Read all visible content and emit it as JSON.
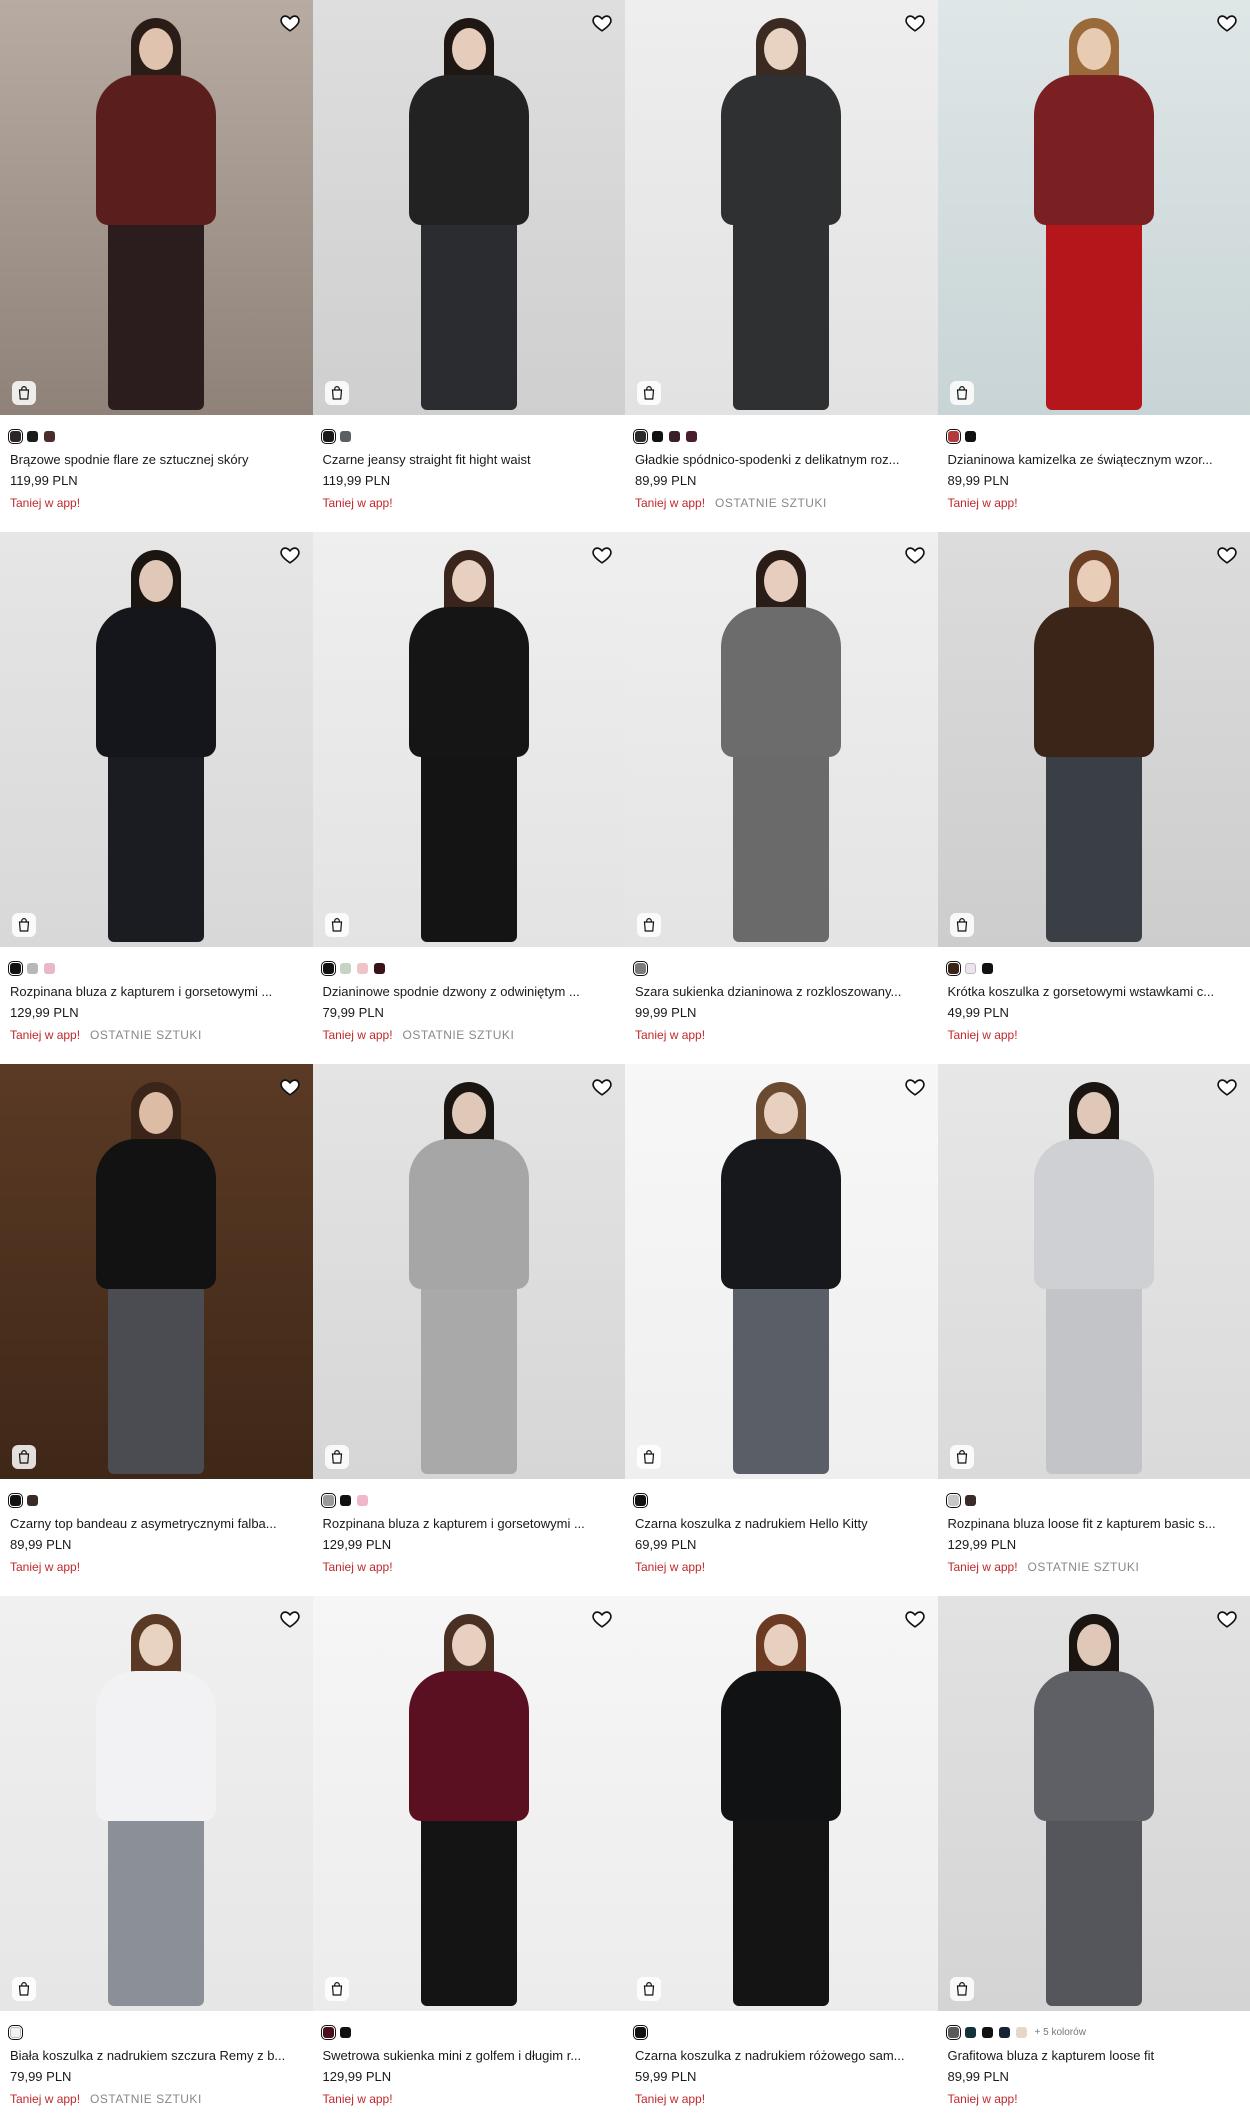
{
  "products": [
    {
      "name": "Brązowe spodnie flare ze sztucznej skóry",
      "price": "119,99 PLN",
      "promo": "Taniej w app!",
      "badge": "",
      "swatches": [
        "#2c2626",
        "#1c1c1c",
        "#4a2d2a"
      ],
      "more": "",
      "bg": [
        "#b7aba2",
        "#8f8279"
      ],
      "top": "#5a1f1d",
      "bottom": "#2b1c1d",
      "hair": "#2a1d17",
      "skin": "#e0c3ae"
    },
    {
      "name": "Czarne jeansy straight fit hight waist",
      "price": "119,99 PLN",
      "promo": "Taniej w app!",
      "badge": "",
      "swatches": [
        "#1a1a1a",
        "#5b5f63"
      ],
      "more": "",
      "bg": [
        "#dedede",
        "#cfcfcf"
      ],
      "top": "#222",
      "bottom": "#2a2c2f",
      "hair": "#1e1714",
      "skin": "#e6ccba"
    },
    {
      "name": "Gładkie spódnico-spodenki z delikatnym roz...",
      "price": "89,99 PLN",
      "promo": "Taniej w app!",
      "badge": "OSTATNIE SZTUKI",
      "swatches": [
        "#2b2b2b",
        "#111",
        "#3a1f26",
        "#4a1e2a"
      ],
      "more": "",
      "bg": [
        "#eeeeee",
        "#e2e2e2"
      ],
      "top": "#2f3032",
      "bottom": "#2f3032",
      "hair": "#3a2a22",
      "skin": "#e8d2c2"
    },
    {
      "name": "Dzianinowa kamizelka ze świątecznym wzor...",
      "price": "89,99 PLN",
      "promo": "Taniej w app!",
      "badge": "",
      "swatches": [
        "#b23a3a",
        "#111"
      ],
      "more": "",
      "bg": [
        "#dfe6e7",
        "#c8d4d6"
      ],
      "top": "#7a1f22",
      "bottom": "#b5161b",
      "hair": "#9a6a3a",
      "skin": "#e8cbb3"
    },
    {
      "name": "Rozpinana bluza z kapturem i gorsetowymi ...",
      "price": "129,99 PLN",
      "promo": "Taniej w app!",
      "badge": "OSTATNIE SZTUKI",
      "swatches": [
        "#111",
        "#b8b8b8",
        "#e9b7c8"
      ],
      "more": "",
      "bg": [
        "#e6e6e6",
        "#d8d8d8"
      ],
      "top": "#14161b",
      "bottom": "#1a1c22",
      "hair": "#1b1512",
      "skin": "#e0c8b8"
    },
    {
      "name": "Dzianinowe spodnie dzwony z odwiniętym ...",
      "price": "79,99 PLN",
      "promo": "Taniej w app!",
      "badge": "OSTATNIE SZTUKI",
      "swatches": [
        "#111",
        "#c9d2c6",
        "#efc4c8",
        "#3a1218"
      ],
      "more": "",
      "bg": [
        "#efefef",
        "#e3e3e3"
      ],
      "top": "#151515",
      "bottom": "#141414",
      "hair": "#3a251c",
      "skin": "#e8d0c0"
    },
    {
      "name": "Szara sukienka dzianinowa z rozkloszowany...",
      "price": "99,99 PLN",
      "promo": "Taniej w app!",
      "badge": "",
      "swatches": [
        "#7c7c7c"
      ],
      "more": "",
      "bg": [
        "#efefef",
        "#e4e4e4"
      ],
      "top": "#6c6c6c",
      "bottom": "#6a6a6a",
      "hair": "#2a1c16",
      "skin": "#e6cdbd"
    },
    {
      "name": "Krótka koszulka z gorsetowymi wstawkami c...",
      "price": "49,99 PLN",
      "promo": "Taniej w app!",
      "badge": "",
      "swatches": [
        "#3a2418",
        "#ece4ef",
        "#111"
      ],
      "more": "",
      "bg": [
        "#dcdcdc",
        "#cdcdcd"
      ],
      "top": "#3b2418",
      "bottom": "#3a3f46",
      "hair": "#6b3f24",
      "skin": "#e8cdb8"
    },
    {
      "name": "Czarny top bandeau z asymetrycznymi falba...",
      "price": "89,99 PLN",
      "promo": "Taniej w app!",
      "badge": "",
      "swatches": [
        "#111",
        "#3a2a28"
      ],
      "more": "",
      "bg": [
        "#5a3a24",
        "#3f2718"
      ],
      "top": "#121212",
      "bottom": "#4a4c52",
      "hair": "#3b2519",
      "skin": "#dcbca4"
    },
    {
      "name": "Rozpinana bluza z kapturem i gorsetowymi ...",
      "price": "129,99 PLN",
      "promo": "Taniej w app!",
      "badge": "",
      "swatches": [
        "#9a9a9a",
        "#111",
        "#efb7c8"
      ],
      "more": "",
      "bg": [
        "#e4e4e4",
        "#d6d6d6"
      ],
      "top": "#a6a6a6",
      "bottom": "#a9a9a9",
      "hair": "#1b1512",
      "skin": "#e0c8b8"
    },
    {
      "name": "Czarna koszulka z nadrukiem Hello Kitty",
      "price": "69,99 PLN",
      "promo": "Taniej w app!",
      "badge": "",
      "swatches": [
        "#111"
      ],
      "more": "",
      "bg": [
        "#f7f7f7",
        "#efefef"
      ],
      "top": "#16181c",
      "bottom": "#5a5e66",
      "hair": "#6a4a30",
      "skin": "#e8d0c0"
    },
    {
      "name": "Rozpinana bluza loose fit z kapturem basic s...",
      "price": "129,99 PLN",
      "promo": "Taniej w app!",
      "badge": "OSTATNIE SZTUKI",
      "swatches": [
        "#c6c6c6",
        "#3a2a28"
      ],
      "more": "",
      "bg": [
        "#e7e7e7",
        "#dadada"
      ],
      "top": "#cfd0d4",
      "bottom": "#c3c4c8",
      "hair": "#1b1512",
      "skin": "#e0c8b8"
    },
    {
      "name": "Biała koszulka z nadrukiem szczura Remy z b...",
      "price": "79,99 PLN",
      "promo": "Taniej w app!",
      "badge": "OSTATNIE SZTUKI",
      "swatches": [
        "#f2f2f2"
      ],
      "more": "",
      "bg": [
        "#f0f0f0",
        "#e6e6e6"
      ],
      "top": "#f2f2f4",
      "bottom": "#8b8f98",
      "hair": "#5a3a24",
      "skin": "#e8d2c2"
    },
    {
      "name": "Swetrowa sukienka mini z golfem i długim r...",
      "price": "129,99 PLN",
      "promo": "Taniej w app!",
      "badge": "",
      "swatches": [
        "#4a0f1c",
        "#111"
      ],
      "more": "",
      "bg": [
        "#f6f6f6",
        "#ececec"
      ],
      "top": "#5a1020",
      "bottom": "#141414",
      "hair": "#4a3022",
      "skin": "#e8d0c0"
    },
    {
      "name": "Czarna koszulka z nadrukiem różowego sam...",
      "price": "59,99 PLN",
      "promo": "Taniej w app!",
      "badge": "",
      "swatches": [
        "#111"
      ],
      "more": "",
      "bg": [
        "#f6f6f6",
        "#ececec"
      ],
      "top": "#111214",
      "bottom": "#141414",
      "hair": "#6a3a22",
      "skin": "#e8d0c0"
    },
    {
      "name": "Grafitowa bluza z kapturem loose fit",
      "price": "89,99 PLN",
      "promo": "Taniej w app!",
      "badge": "",
      "swatches": [
        "#5a5a5a",
        "#14323a",
        "#111",
        "#172436",
        "#e6d6c8"
      ],
      "more": "+ 5 kolorów",
      "bg": [
        "#e2e2e2",
        "#d4d4d4"
      ],
      "top": "#5f6066",
      "bottom": "#55565c",
      "hair": "#1b1512",
      "skin": "#e0c8b8"
    }
  ],
  "labels": {
    "wishlist": "heart-icon",
    "add_to_bag": "bag-icon"
  }
}
